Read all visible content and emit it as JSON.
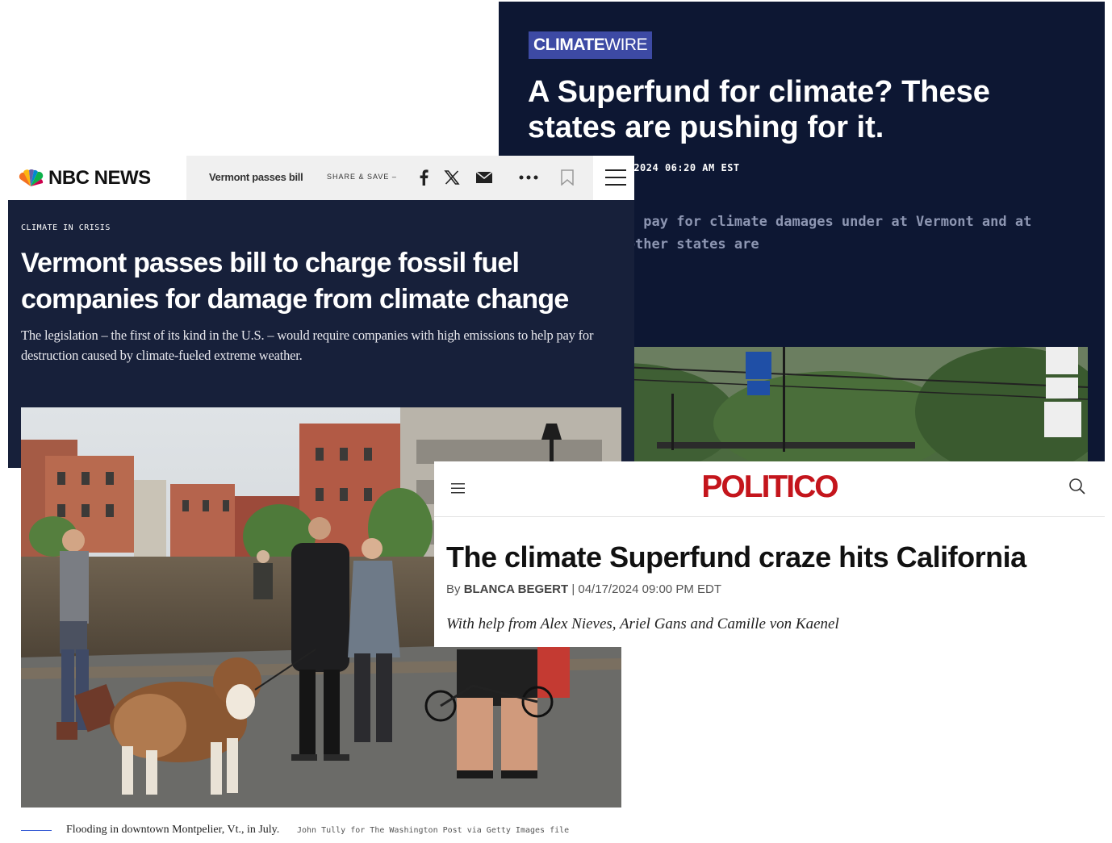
{
  "climatewire": {
    "badge_bold": "CLIMATE",
    "badge_light": "WIRE",
    "headline": "A Superfund for climate? These states are pushing for it.",
    "byline": "ey Clark | 03/06/2024 06:20 AM EST",
    "summary": "mpanies would pay for climate damages under at Vermont and at least three other states are"
  },
  "nbc": {
    "logo_text": "NBC NEWS",
    "short_title": "Vermont passes bill",
    "share_label": "SHARE & SAVE –",
    "kicker": "CLIMATE IN CRISIS",
    "headline": "Vermont passes bill to charge fossil fuel companies for damage from climate change",
    "dek": "The legislation – the first of its kind in the U.S. – would require companies with high emissions to help pay for destruction caused by climate-fueled extreme weather.",
    "caption": "Flooding in downtown Montpelier, Vt., in July.",
    "credit": "John Tully for The Washington Post via Getty Images file",
    "icons": [
      "facebook-icon",
      "x-icon",
      "email-icon",
      "more-icon",
      "bookmark-icon",
      "menu-icon"
    ]
  },
  "politico": {
    "logo": "POLITICO",
    "headline": "The climate Superfund craze hits California",
    "by": "By",
    "author": "BLANCA BEGERT",
    "date": "| 04/17/2024 09:00 PM EDT",
    "help": "With help from Alex Nieves, Ariel Gans and Camille von Kaenel"
  },
  "colors": {
    "climatewire_bg": "#0d1733",
    "climatewire_badge": "#3d4aa4",
    "nbc_bg": "#17203a",
    "politico_red": "#c4151c"
  }
}
